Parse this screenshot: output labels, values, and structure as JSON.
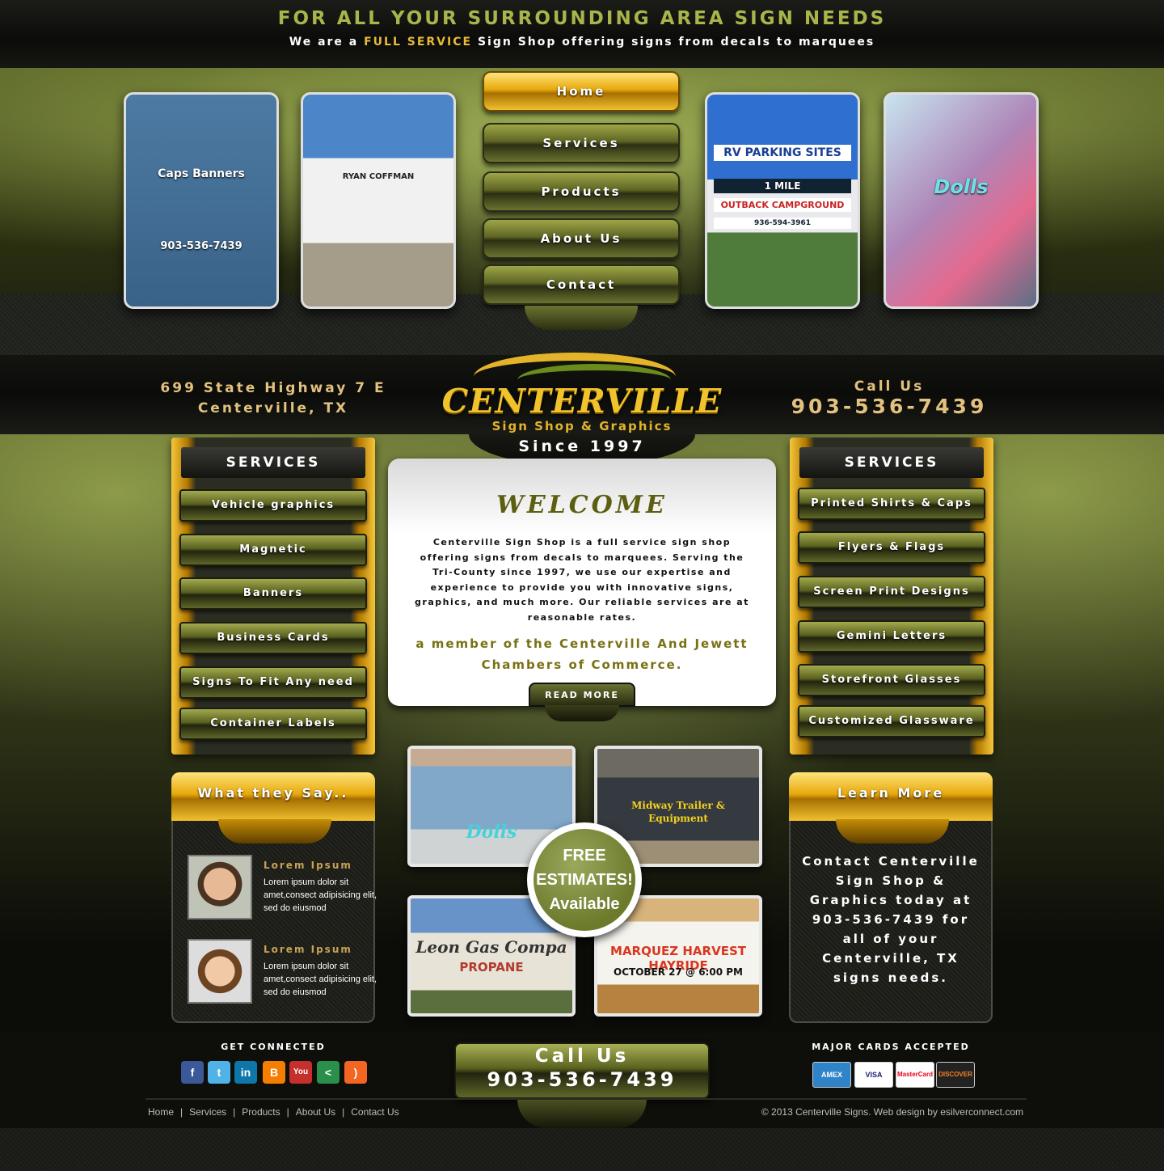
{
  "header": {
    "tagline": "FOR ALL YOUR SURROUNDING AREA SIGN NEEDS",
    "subline_pre": "We are a ",
    "subline_highlight": "FULL SERVICE",
    "subline_post": " Sign Shop offering signs from decals to marquees"
  },
  "hero_photos": [
    {
      "caption1": "Caps Banners",
      "caption2": "903-536-7439"
    },
    {
      "caption1": "RYAN COFFMAN"
    },
    {
      "caption1": "RV PARKING SITES",
      "caption2": "1 MILE",
      "caption3": "OUTBACK CAMPGROUND",
      "caption4": "936-594-3961"
    },
    {
      "caption1": "Dolls"
    }
  ],
  "nav": {
    "items": [
      {
        "label": "Home"
      },
      {
        "label": "Services"
      },
      {
        "label": "Products"
      },
      {
        "label": "About Us"
      },
      {
        "label": "Contact"
      }
    ]
  },
  "brand": {
    "address_line1": "699 State Highway 7 E",
    "address_line2": "Centerville, TX",
    "call_label": "Call Us",
    "phone": "903-536-7439",
    "logo_name": "CENTERVILLE",
    "logo_sub": "Sign Shop & Graphics",
    "since": "Since 1997"
  },
  "services_left": {
    "title": "SERVICES",
    "items": [
      {
        "label": "Vehicle graphics"
      },
      {
        "label": "Magnetic"
      },
      {
        "label": "Banners"
      },
      {
        "label": "Business Cards"
      },
      {
        "label": "Signs To Fit Any need"
      },
      {
        "label": "Container Labels"
      }
    ]
  },
  "services_right": {
    "title": "SERVICES",
    "items": [
      {
        "label": "Printed Shirts & Caps"
      },
      {
        "label": "Flyers & Flags"
      },
      {
        "label": "Screen Print Designs"
      },
      {
        "label": "Gemini Letters"
      },
      {
        "label": "Storefront Glasses"
      },
      {
        "label": "Customized Glassware"
      }
    ]
  },
  "welcome": {
    "title": "WELCOME",
    "body": "Centerville Sign Shop is a full service sign shop offering signs from decals to marquees. Serving the Tri-County since 1997, we use our expertise and experience to provide you with innovative signs, graphics, and much more. Our reliable services are at reasonable rates.",
    "member": "a member of the Centerville And Jewett Chambers of Commerce.",
    "read_more": "READ MORE"
  },
  "testimonials": {
    "title": "What they Say..",
    "items": [
      {
        "name": "Lorem Ipsum",
        "text": "Lorem ipsum dolor sit amet,consect adipisicing elit, sed do eiusmod"
      },
      {
        "name": "Lorem Ipsum",
        "text": "Lorem ipsum dolor sit amet,consect adipisicing elit, sed do eiusmod"
      }
    ]
  },
  "gallery": [
    {
      "caption1": "Dolls"
    },
    {
      "caption1": "Midway Trailer & Equipment"
    },
    {
      "caption1": "Leon Gas Compa",
      "caption2": "PROPANE"
    },
    {
      "caption1": "MARQUEZ HARVEST HAYRIDE",
      "caption2": "OCTOBER 27 @ 6:00 PM"
    }
  ],
  "sticker": {
    "line1": "FREE",
    "line2": "ESTIMATES!",
    "line3": "Available"
  },
  "learn_more": {
    "title": "Learn More",
    "text": "Contact Centerville Sign Shop & Graphics today at 903-536-7439 for all of your Centerville, TX signs needs."
  },
  "footer": {
    "get_connected": "GET CONNECTED",
    "social": [
      {
        "icon": "facebook-icon",
        "glyph": "f"
      },
      {
        "icon": "twitter-icon",
        "glyph": "t"
      },
      {
        "icon": "linkedin-icon",
        "glyph": "in"
      },
      {
        "icon": "blogger-icon",
        "glyph": "B"
      },
      {
        "icon": "youtube-icon",
        "glyph": "You"
      },
      {
        "icon": "share-icon",
        "glyph": "<"
      },
      {
        "icon": "rss-icon",
        "glyph": ")"
      }
    ],
    "call_label": "Call Us",
    "call_number": "903-536-7439",
    "cards_label": "MAJOR CARDS ACCEPTED",
    "cards": [
      {
        "icon": "american-express-icon",
        "label": "AMEX"
      },
      {
        "icon": "visa-icon",
        "label": "VISA"
      },
      {
        "icon": "mastercard-icon",
        "label": "MasterCard"
      },
      {
        "icon": "discover-icon",
        "label": "DISCOVER"
      }
    ],
    "links": [
      {
        "label": "Home"
      },
      {
        "label": "Services"
      },
      {
        "label": "Products"
      },
      {
        "label": "About Us"
      },
      {
        "label": "Contact Us"
      }
    ],
    "copyright": "© 2013 Centerville Signs. Web design by esilverconnect.com"
  },
  "colors": {
    "gold": "#e7a90c",
    "olive": "#5e6524",
    "text_gold": "#e3c17e",
    "welcome_title": "#5c5e10"
  }
}
